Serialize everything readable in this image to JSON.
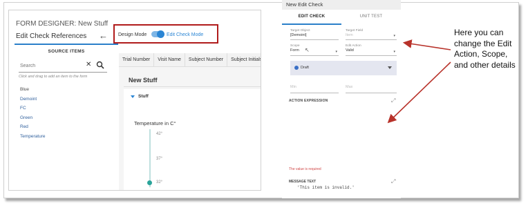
{
  "designer": {
    "title": "FORM DESIGNER: New Stuff",
    "subtitle": "Edit Check References",
    "source_items_title": "SOURCE ITEMS",
    "search_placeholder": "Search",
    "hint": "Click and drag to add an item to the form",
    "source_items": [
      "Blue",
      "Demoint",
      "FC",
      "Green",
      "Red",
      "Temperature"
    ],
    "design_mode_label": "Design Mode",
    "edit_check_mode_label": "Edit Check Mode",
    "columns": [
      "Trial Number",
      "Visit Name",
      "Subject Number",
      "Subject Initials"
    ],
    "form_name": "New Stuff",
    "section_name": "Stuff",
    "temperature_label": "Temperature in C°",
    "slider_ticks": [
      "42°",
      "37°",
      "32°"
    ]
  },
  "edit_check": {
    "panel_title": "New Edit Check",
    "tabs": [
      "EDIT CHECK",
      "UNIT TEST"
    ],
    "target_object_label": "Target Object",
    "target_object_value": "[Demoint]",
    "target_field_label": "Target Field",
    "target_field_value": "Item",
    "scope_label": "Scope",
    "scope_value": "Form",
    "edit_action_label": "Edit Action",
    "edit_action_value": "Valid",
    "status": "Draft",
    "min_placeholder": "Min",
    "max_placeholder": "Max",
    "action_expression_label": "ACTION EXPRESSION",
    "required_text": "The value is required",
    "message_text_label": "MESSAGE TEXT",
    "message_text_value": "'This item is invalid.'"
  },
  "annotation": {
    "text": "Here you can change the Edit Action, Scope, and other details"
  },
  "colors": {
    "accent": "#2a85d4",
    "highlight_box": "#b01b1b",
    "arrow": "#b8322a"
  }
}
